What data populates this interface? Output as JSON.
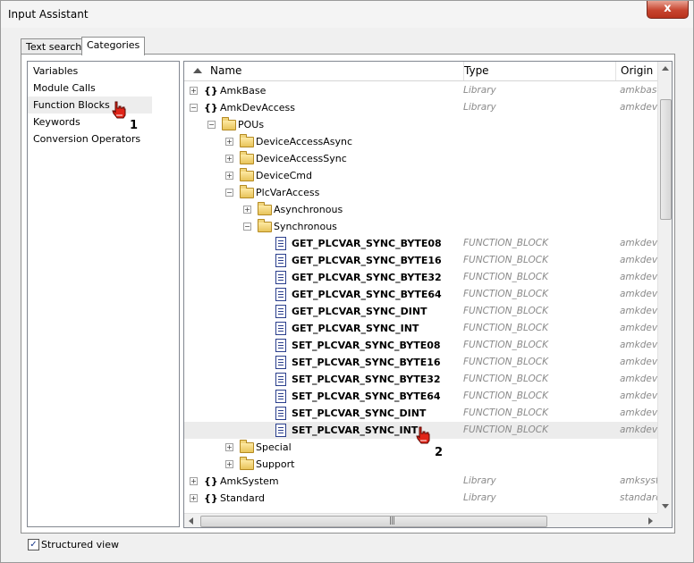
{
  "window": {
    "title": "Input Assistant",
    "close_label": "x"
  },
  "tabs": [
    {
      "label": "Text search",
      "active": false
    },
    {
      "label": "Categories",
      "active": true
    }
  ],
  "categories": [
    {
      "label": "Variables",
      "selected": false
    },
    {
      "label": "Module Calls",
      "selected": false
    },
    {
      "label": "Function Blocks",
      "selected": true
    },
    {
      "label": "Keywords",
      "selected": false
    },
    {
      "label": "Conversion Operators",
      "selected": false
    }
  ],
  "callouts": {
    "one": "1",
    "two": "2"
  },
  "columns": {
    "name": "Name",
    "type": "Type",
    "origin": "Origin"
  },
  "tree": [
    {
      "label": "AmkBase",
      "type": "Library",
      "origin": "amkbase",
      "icon": "library-icon",
      "level": 0,
      "expander": "+"
    },
    {
      "label": "AmkDevAccess",
      "type": "Library",
      "origin": "amkdeva",
      "icon": "library-icon",
      "level": 0,
      "expander": "-"
    },
    {
      "label": "POUs",
      "type": "",
      "origin": "",
      "icon": "folder-icon",
      "level": 1,
      "expander": "-"
    },
    {
      "label": "DeviceAccessAsync",
      "type": "",
      "origin": "",
      "icon": "folder-icon",
      "level": 2,
      "expander": "+"
    },
    {
      "label": "DeviceAccessSync",
      "type": "",
      "origin": "",
      "icon": "folder-icon",
      "level": 2,
      "expander": "+"
    },
    {
      "label": "DeviceCmd",
      "type": "",
      "origin": "",
      "icon": "folder-icon",
      "level": 2,
      "expander": "+"
    },
    {
      "label": "PlcVarAccess",
      "type": "",
      "origin": "",
      "icon": "folder-icon",
      "level": 2,
      "expander": "-"
    },
    {
      "label": "Asynchronous",
      "type": "",
      "origin": "",
      "icon": "folder-icon",
      "level": 3,
      "expander": "+"
    },
    {
      "label": "Synchronous",
      "type": "",
      "origin": "",
      "icon": "folder-icon",
      "level": 3,
      "expander": "-"
    },
    {
      "label": "GET_PLCVAR_SYNC_BYTE08",
      "type": "FUNCTION_BLOCK",
      "origin": "amkdeva",
      "icon": "function-block-icon",
      "level": 4,
      "expander": ""
    },
    {
      "label": "GET_PLCVAR_SYNC_BYTE16",
      "type": "FUNCTION_BLOCK",
      "origin": "amkdeva",
      "icon": "function-block-icon",
      "level": 4,
      "expander": ""
    },
    {
      "label": "GET_PLCVAR_SYNC_BYTE32",
      "type": "FUNCTION_BLOCK",
      "origin": "amkdeva",
      "icon": "function-block-icon",
      "level": 4,
      "expander": ""
    },
    {
      "label": "GET_PLCVAR_SYNC_BYTE64",
      "type": "FUNCTION_BLOCK",
      "origin": "amkdeva",
      "icon": "function-block-icon",
      "level": 4,
      "expander": ""
    },
    {
      "label": "GET_PLCVAR_SYNC_DINT",
      "type": "FUNCTION_BLOCK",
      "origin": "amkdeva",
      "icon": "function-block-icon",
      "level": 4,
      "expander": ""
    },
    {
      "label": "GET_PLCVAR_SYNC_INT",
      "type": "FUNCTION_BLOCK",
      "origin": "amkdeva",
      "icon": "function-block-icon",
      "level": 4,
      "expander": ""
    },
    {
      "label": "SET_PLCVAR_SYNC_BYTE08",
      "type": "FUNCTION_BLOCK",
      "origin": "amkdeva",
      "icon": "function-block-icon",
      "level": 4,
      "expander": ""
    },
    {
      "label": "SET_PLCVAR_SYNC_BYTE16",
      "type": "FUNCTION_BLOCK",
      "origin": "amkdeva",
      "icon": "function-block-icon",
      "level": 4,
      "expander": ""
    },
    {
      "label": "SET_PLCVAR_SYNC_BYTE32",
      "type": "FUNCTION_BLOCK",
      "origin": "amkdeva",
      "icon": "function-block-icon",
      "level": 4,
      "expander": ""
    },
    {
      "label": "SET_PLCVAR_SYNC_BYTE64",
      "type": "FUNCTION_BLOCK",
      "origin": "amkdeva",
      "icon": "function-block-icon",
      "level": 4,
      "expander": ""
    },
    {
      "label": "SET_PLCVAR_SYNC_DINT",
      "type": "FUNCTION_BLOCK",
      "origin": "amkdeva",
      "icon": "function-block-icon",
      "level": 4,
      "expander": ""
    },
    {
      "label": "SET_PLCVAR_SYNC_INT",
      "type": "FUNCTION_BLOCK",
      "origin": "amkdeva",
      "icon": "function-block-icon",
      "level": 4,
      "expander": "",
      "highlighted": true
    },
    {
      "label": "Special",
      "type": "",
      "origin": "",
      "icon": "folder-icon",
      "level": 2,
      "expander": "+"
    },
    {
      "label": "Support",
      "type": "",
      "origin": "",
      "icon": "folder-icon",
      "level": 2,
      "expander": "+"
    },
    {
      "label": "AmkSystem",
      "type": "Library",
      "origin": "amksyst",
      "icon": "library-icon",
      "level": 0,
      "expander": "+"
    },
    {
      "label": "Standard",
      "type": "Library",
      "origin": "standard",
      "icon": "library-icon",
      "level": 0,
      "expander": "+"
    }
  ],
  "structured_view": {
    "label": "Structured view",
    "checked": true
  },
  "colors": {
    "accent": "#2a3e8c",
    "close": "#c7452f",
    "muted_text": "#8a8a8a"
  }
}
